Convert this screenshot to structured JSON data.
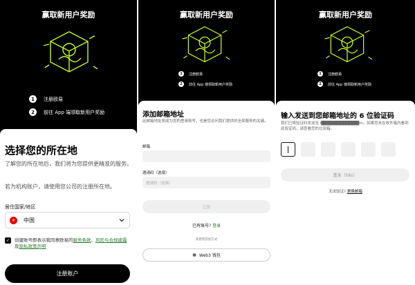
{
  "hero": {
    "title": "赢取新用户奖励"
  },
  "steps": [
    {
      "num": "1",
      "text": "注册欧易"
    },
    {
      "num": "2",
      "text": "前往 App 端领取新用户奖励"
    }
  ],
  "location_screen": {
    "title": "选择您的所在地",
    "desc1": "了解您的所在地后，我们将为您提供更精准的服务。",
    "desc2": "若为机构账户，请使用您公司的注册所在地。",
    "country_label": "居住国家/地区",
    "country_value": "中国",
    "terms_prefix": "创建账号即表示我同意欧易的",
    "terms_link1": "服务条款",
    "terms_sep": "、",
    "terms_link2": "风险与合规披露",
    "terms_and": "及",
    "terms_link3": "隐私政策声明",
    "cta": "注册账户"
  },
  "email_screen": {
    "title": "添加邮箱地址",
    "desc": "此邮箱地址将成为您的登录账号，也是您访问我们提供的全部服务的关键。",
    "email_label": "邮箱",
    "referral_label": "邀请码（选填）",
    "referral_placeholder": "邀请码（选填）",
    "register_button": "注册",
    "have_account": "已有账号?",
    "login_link": "登录",
    "divider": "或使用其他方式",
    "web3_button": "Web3 钱包"
  },
  "verify_screen": {
    "title": "输入发送到您邮箱地址的 6 位验证码",
    "desc": "我们已将验证码发送至 l█████████████m。如果您未在收件箱内看到此验证码，请查看您的垃圾箱。",
    "resend": "重发（58s）",
    "no_verify": "无法验证?",
    "change_email": "更换邮箱"
  },
  "colors": {
    "background": "#000000",
    "accent": "#2e7d32",
    "flag_red": "#e60012"
  },
  "icons": {
    "logo": "okx-cube-logo",
    "flag": "china-flag-icon",
    "chevron": "chevron-down-icon",
    "check": "check-icon"
  }
}
